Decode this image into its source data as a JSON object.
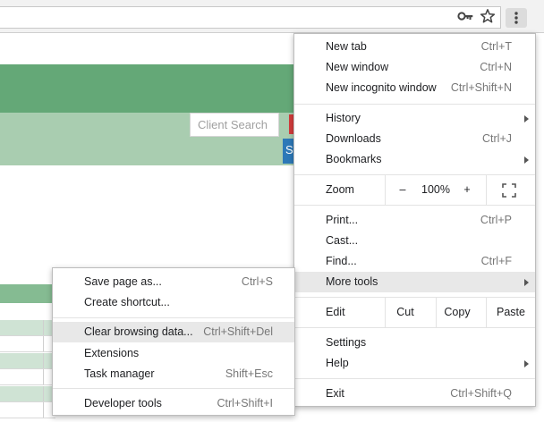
{
  "toolbar": {
    "icons": [
      "key-icon",
      "star-icon",
      "more-vert-icon"
    ]
  },
  "page": {
    "search_placeholder": "Client Search",
    "blue_button_text": "S",
    "colors": {
      "header_green": "#64a877",
      "light_green": "#a9cdb0",
      "blue": "#2d79b8",
      "red": "#d23b3b"
    }
  },
  "main_menu": {
    "new_tab": {
      "label": "New tab",
      "shortcut": "Ctrl+T"
    },
    "new_window": {
      "label": "New window",
      "shortcut": "Ctrl+N"
    },
    "new_incognito": {
      "label": "New incognito window",
      "shortcut": "Ctrl+Shift+N"
    },
    "history": {
      "label": "History"
    },
    "downloads": {
      "label": "Downloads",
      "shortcut": "Ctrl+J"
    },
    "bookmarks": {
      "label": "Bookmarks"
    },
    "zoom": {
      "label": "Zoom",
      "minus": "–",
      "value": "100%",
      "plus": "+"
    },
    "print": {
      "label": "Print...",
      "shortcut": "Ctrl+P"
    },
    "cast": {
      "label": "Cast..."
    },
    "find": {
      "label": "Find...",
      "shortcut": "Ctrl+F"
    },
    "more_tools": {
      "label": "More tools"
    },
    "edit": {
      "label": "Edit",
      "cut": "Cut",
      "copy": "Copy",
      "paste": "Paste"
    },
    "settings": {
      "label": "Settings"
    },
    "help": {
      "label": "Help"
    },
    "exit": {
      "label": "Exit",
      "shortcut": "Ctrl+Shift+Q"
    }
  },
  "sub_menu": {
    "save_page": {
      "label": "Save page as...",
      "shortcut": "Ctrl+S"
    },
    "create_shortcut": {
      "label": "Create shortcut..."
    },
    "clear_browsing": {
      "label": "Clear browsing data...",
      "shortcut": "Ctrl+Shift+Del"
    },
    "extensions": {
      "label": "Extensions"
    },
    "task_manager": {
      "label": "Task manager",
      "shortcut": "Shift+Esc"
    },
    "developer_tools": {
      "label": "Developer tools",
      "shortcut": "Ctrl+Shift+I"
    }
  }
}
